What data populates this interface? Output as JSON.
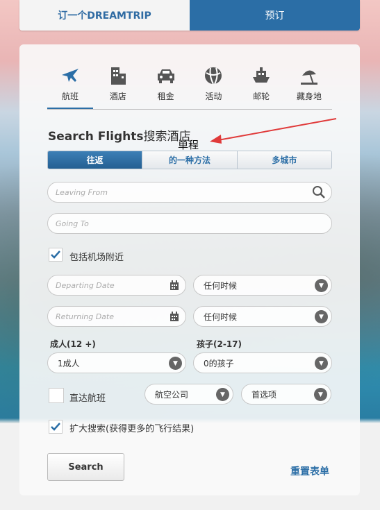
{
  "top_tabs": {
    "left": "订一个DREAMTRIP",
    "right": "预订"
  },
  "categories": [
    {
      "label": "航班",
      "icon": "airplane-icon"
    },
    {
      "label": "酒店",
      "icon": "building-icon"
    },
    {
      "label": "租金",
      "icon": "car-icon"
    },
    {
      "label": "活动",
      "icon": "ball-icon"
    },
    {
      "label": "邮轮",
      "icon": "ship-icon"
    },
    {
      "label": "藏身地",
      "icon": "beach-icon"
    }
  ],
  "heading": {
    "en": "Search Flights",
    "cn": "搜索酒店"
  },
  "annotation": "单程",
  "trip_types": [
    "往返",
    "的一种方法",
    "多城市"
  ],
  "leaving_from": {
    "placeholder": "Leaving From"
  },
  "going_to": {
    "placeholder": "Going To"
  },
  "nearby_airports": {
    "label": "包括机场附近",
    "checked": true
  },
  "departing": {
    "placeholder": "Departing Date",
    "time": "任何时候"
  },
  "returning": {
    "placeholder": "Returning Date",
    "time": "任何时候"
  },
  "adults": {
    "label": "成人(12 +)",
    "value": "1成人"
  },
  "children": {
    "label": "孩子(2-17)",
    "value": "0的孩子"
  },
  "nonstop": {
    "label": "直达航班",
    "checked": false
  },
  "airline": {
    "value": "航空公司"
  },
  "preference": {
    "value": "首选项"
  },
  "expand_search": {
    "label": "扩大搜索(获得更多的飞行结果)",
    "checked": true
  },
  "search_button": "Search",
  "reset_link": "重置表单"
}
